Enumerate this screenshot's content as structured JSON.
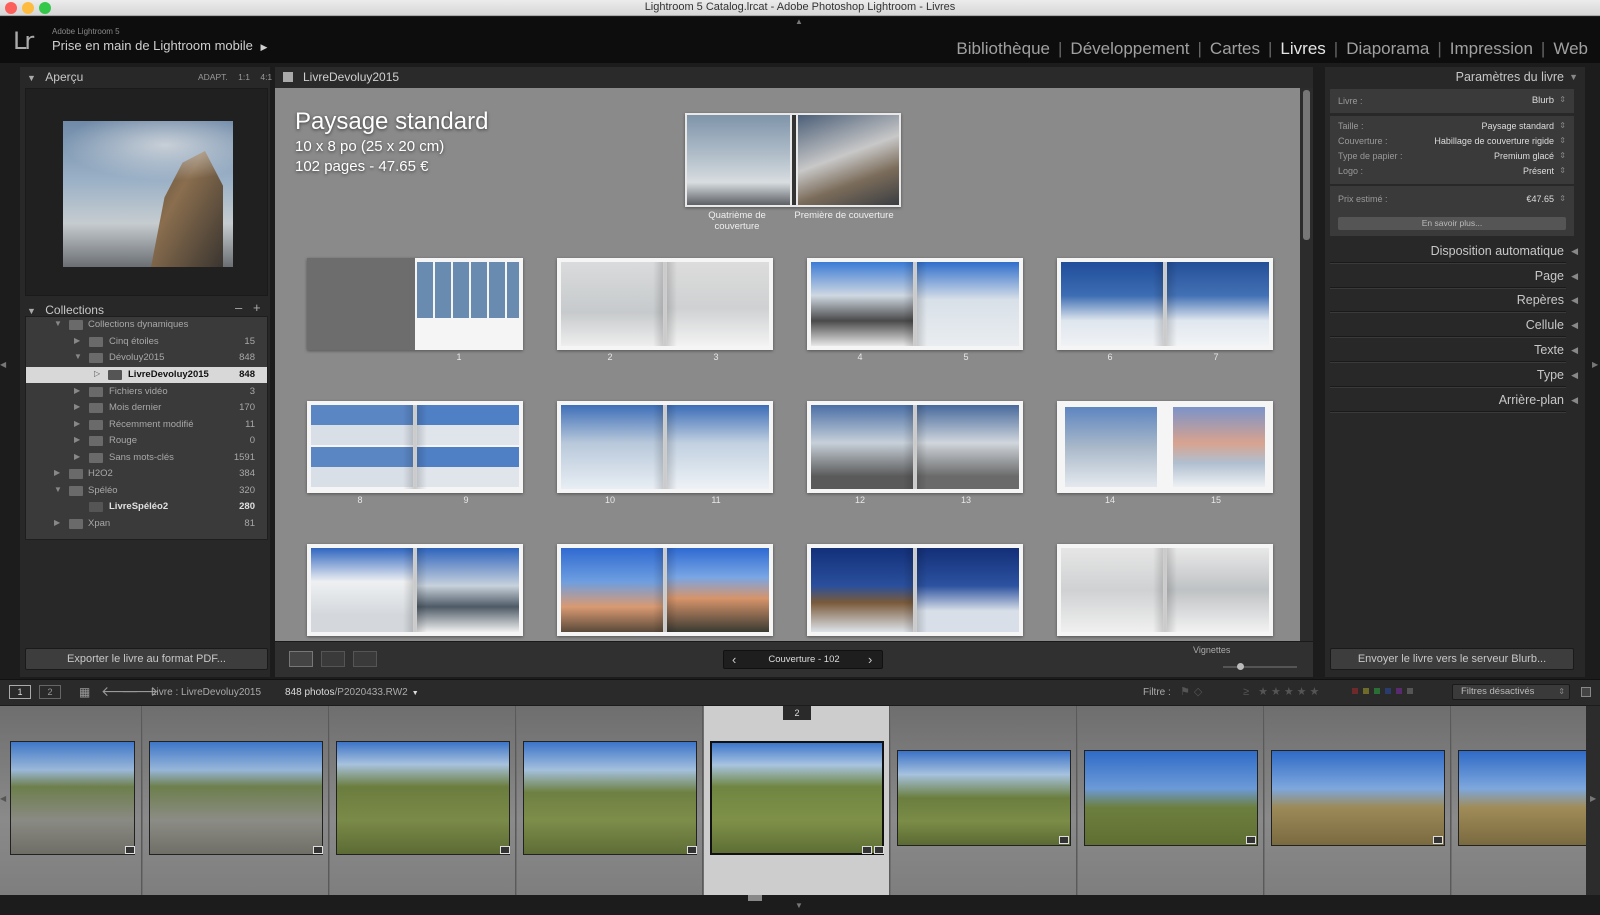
{
  "window": {
    "title": "Lightroom 5 Catalog.lrcat - Adobe Photoshop Lightroom - Livres"
  },
  "identity": {
    "logo": "Lr",
    "small": "Adobe Lightroom 5",
    "main": "Prise en main de Lightroom mobile",
    "arrow": "▶"
  },
  "modules": [
    "Bibliothèque",
    "Développement",
    "Cartes",
    "Livres",
    "Diaporama",
    "Impression",
    "Web"
  ],
  "active_module": "Livres",
  "left": {
    "preview": {
      "title": "Aperçu",
      "zooms": [
        "ADAPT.",
        "1:1",
        "4:1"
      ]
    },
    "collections": {
      "title": "Collections",
      "minus": "–",
      "plus": "+",
      "items": [
        {
          "name": "Collections dynamiques",
          "count": ""
        },
        {
          "name": "Cinq étoiles",
          "count": "15"
        },
        {
          "name": "Dévoluy2015",
          "count": "848"
        },
        {
          "name": "LivreDevoluy2015",
          "count": "848"
        },
        {
          "name": "Fichiers vidéo",
          "count": "3"
        },
        {
          "name": "Mois dernier",
          "count": "170"
        },
        {
          "name": "Récemment modifié",
          "count": "11"
        },
        {
          "name": "Rouge",
          "count": "0"
        },
        {
          "name": "Sans mots-clés",
          "count": "1591"
        },
        {
          "name": "H2O2",
          "count": "384"
        },
        {
          "name": "Spéléo",
          "count": "320"
        },
        {
          "name": "LivreSpéléo2",
          "count": "280"
        },
        {
          "name": "Xpan",
          "count": "81"
        }
      ]
    },
    "export_button": "Exporter le livre au format PDF..."
  },
  "center": {
    "collection_title": "LivreDevoluy2015",
    "book_title": "Paysage standard",
    "book_size": "10 x 8 po (25 x 20 cm)",
    "book_pages": "102 pages - 47.65 €",
    "cover_back": "Quatrième de couverture",
    "cover_front": "Première de couverture",
    "page_numbers": [
      "1",
      "2",
      "3",
      "4",
      "5",
      "6",
      "7",
      "8",
      "9",
      "10",
      "11",
      "12",
      "13",
      "14",
      "15"
    ]
  },
  "toolbar": {
    "nav": "Couverture - 102",
    "prev": "‹",
    "next": "›",
    "vignettes": "Vignettes"
  },
  "right": {
    "header": "Paramètres du livre",
    "livre_label": "Livre :",
    "livre_value": "Blurb",
    "props": [
      {
        "label": "Taille :",
        "value": "Paysage standard"
      },
      {
        "label": "Couverture :",
        "value": "Habillage de couverture rigide"
      },
      {
        "label": "Type de papier :",
        "value": "Premium glacé"
      },
      {
        "label": "Logo :",
        "value": "Présent"
      }
    ],
    "price_label": "Prix estimé :",
    "price_value": "€47.65",
    "learn_more": "En savoir plus...",
    "sections": [
      "Disposition automatique",
      "Page",
      "Repères",
      "Cellule",
      "Texte",
      "Type",
      "Arrière-plan"
    ],
    "send_button": "Envoyer le livre vers le serveur Blurb..."
  },
  "filmstrip_bar": {
    "view1": "1",
    "view2": "2",
    "source": "Livre : LivreDevoluy2015",
    "count": "848 photos",
    "file": "/P2020433.RW2",
    "filter_label": "Filtre :",
    "filter_value": "Filtres désactivés",
    "selected_badge": "2"
  },
  "colors": {
    "accent": "#e6e6e6",
    "panel": "#282828",
    "background": "#8a8a8a"
  }
}
